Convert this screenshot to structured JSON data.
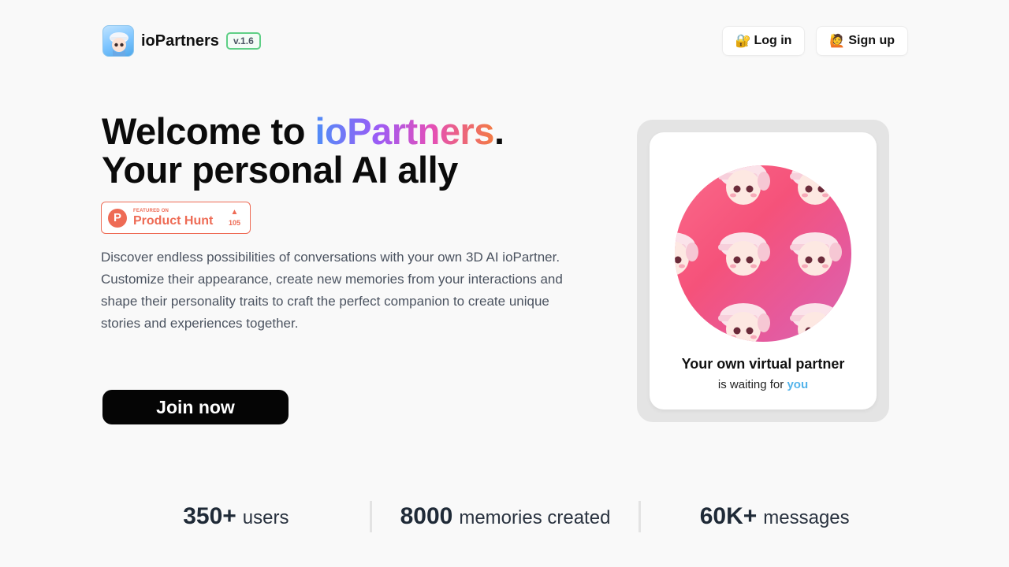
{
  "header": {
    "brand_name": "ioPartners",
    "version": "v.1.6",
    "login_label": "Log in",
    "login_emoji": "🔐",
    "signup_label": "Sign up",
    "signup_emoji": "🙋"
  },
  "hero": {
    "title_prefix": "Welcome to ",
    "title_brand": "ioPartners",
    "title_suffix": ".",
    "title_line2": "Your personal AI ally",
    "description": "Discover endless possibilities of conversations with your own 3D AI ioPartner. Customize their appearance, create new memories from your interactions and shape their personality traits to craft the perfect companion to create unique stories and experiences together.",
    "join_label": "Join now"
  },
  "product_hunt": {
    "logo_letter": "P",
    "featured_label": "FEATURED ON",
    "name": "Product Hunt",
    "arrow": "▲",
    "votes": "105",
    "color": "#ee6b55"
  },
  "card": {
    "title": "Your own virtual partner",
    "subtitle_prefix": "is waiting for ",
    "subtitle_highlight": "you"
  },
  "stats": [
    {
      "value": "350+",
      "label": "users"
    },
    {
      "value": "8000",
      "label": "memories created"
    },
    {
      "value": "60K+",
      "label": "messages"
    }
  ],
  "colors": {
    "background": "#f9f9f9",
    "version_border": "#5fcf86",
    "highlight_blue": "#52b3ea",
    "gradient": [
      "#4f8ef7",
      "#9b5cf6",
      "#e44fb8",
      "#f37b43"
    ]
  },
  "icons": {
    "logo": "character-avatar-icon",
    "login": "lock-key-icon",
    "signup": "raising-hand-icon",
    "product_hunt": "product-hunt-logo",
    "upvote": "upvote-arrow-icon"
  }
}
